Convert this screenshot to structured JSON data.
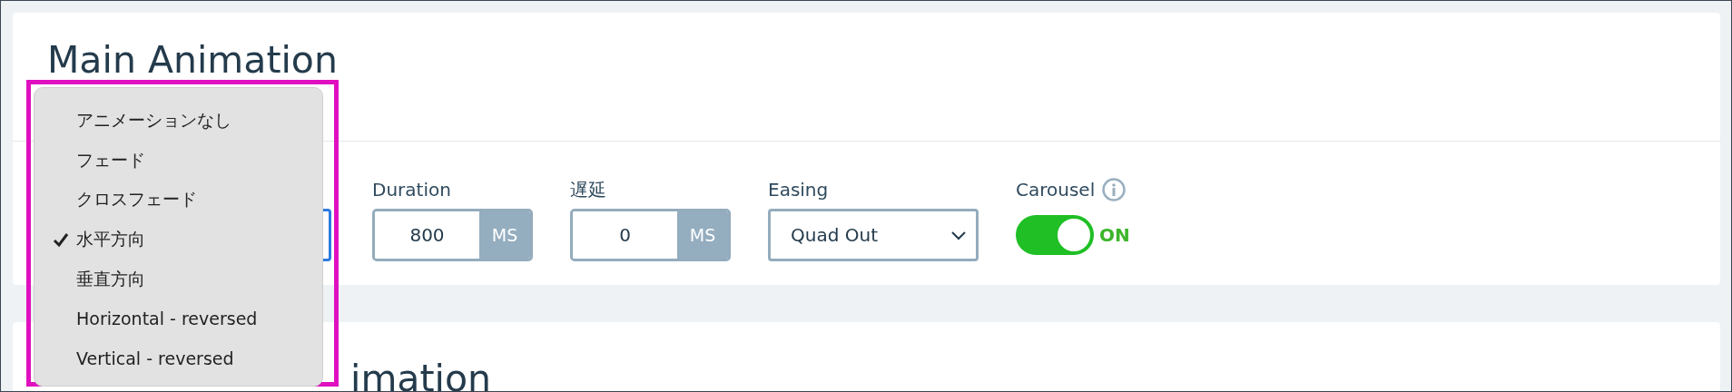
{
  "title": "Main Animation",
  "transition_menu": {
    "items": [
      {
        "label": "アニメーションなし",
        "selected": false
      },
      {
        "label": "フェード",
        "selected": false
      },
      {
        "label": "クロスフェード",
        "selected": false
      },
      {
        "label": "水平方向",
        "selected": true
      },
      {
        "label": "垂直方向",
        "selected": false
      },
      {
        "label": "Horizontal - reversed",
        "selected": false
      },
      {
        "label": "Vertical - reversed",
        "selected": false
      }
    ]
  },
  "fields": [
    {
      "kind": "number",
      "label": "Duration",
      "value": "800",
      "unit": "MS"
    },
    {
      "kind": "number",
      "label": "遅延",
      "value": "0",
      "unit": "MS"
    },
    {
      "kind": "select",
      "label": "Easing",
      "value": "Quad Out"
    },
    {
      "kind": "toggle",
      "label": "Carousel",
      "on": true,
      "state_text": "ON"
    }
  ],
  "next_section": {
    "title": "imation"
  }
}
